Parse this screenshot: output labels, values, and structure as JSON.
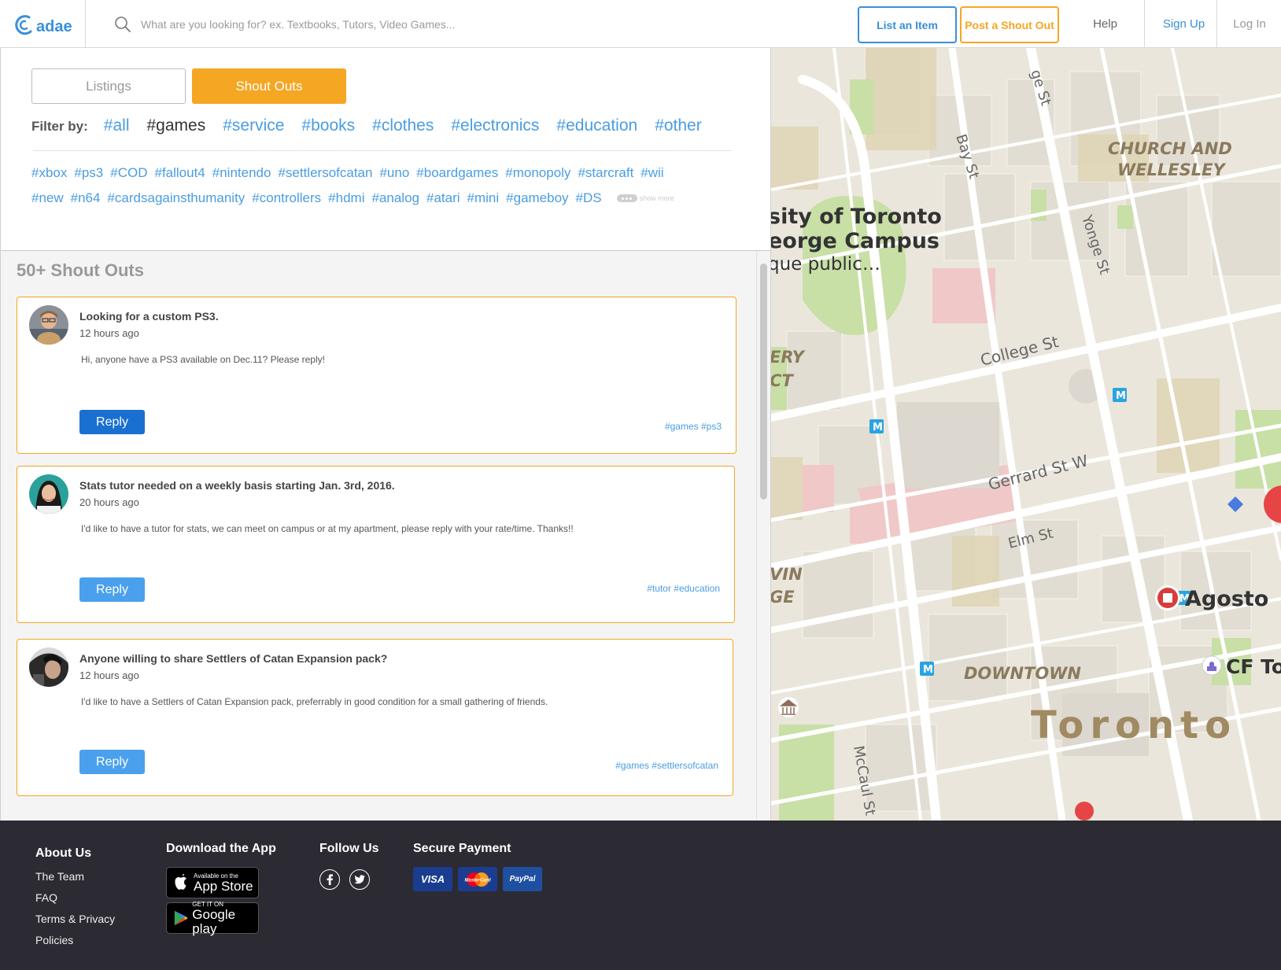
{
  "header": {
    "logo_text": "adae",
    "search_placeholder": "What are you looking for? ex. Textbooks, Tutors, Video Games...",
    "list_item_label": "List an Item",
    "post_shout_label": "Post a Shout Out",
    "help_label": "Help",
    "signup_label": "Sign Up",
    "login_label": "Log In"
  },
  "tabs": {
    "listings": "Listings",
    "shoutouts": "Shout Outs"
  },
  "filter": {
    "label": "Filter by:",
    "categories": [
      "#all",
      "#games",
      "#service",
      "#books",
      "#clothes",
      "#electronics",
      "#education",
      "#other"
    ],
    "active": "#games"
  },
  "tags": {
    "row1": [
      "#xbox",
      "#ps3",
      "#COD",
      "#fallout4",
      "#nintendo",
      "#settlersofcatan",
      "#uno",
      "#boardgames",
      "#monopoly",
      "#starcraft",
      "#wii"
    ],
    "row2": [
      "#new",
      "#n64",
      "#cardsagainsthumanity",
      "#controllers",
      "#hdmi",
      "#analog",
      "#atari",
      "#mini",
      "#gameboy",
      "#DS"
    ],
    "show_more": "show more"
  },
  "feed": {
    "title": "50+ Shout Outs",
    "posts": [
      {
        "title": "Looking for a custom PS3.",
        "time": "12 hours ago",
        "body": "Hi, anyone have a PS3 available on Dec.11?  Please reply!",
        "reply": "Reply",
        "tags": "#games #ps3"
      },
      {
        "title": "Stats tutor needed on a weekly basis starting Jan. 3rd, 2016.",
        "time": "20 hours ago",
        "body": "I'd like to have a tutor for stats, we can meet on campus or at my apartment, please reply with your rate/time. Thanks!!",
        "reply": "Reply",
        "tags": "#tutor #education"
      },
      {
        "title": "Anyone willing to share Settlers of Catan Expansion pack?",
        "time": "12 hours ago",
        "body": "I'd like to have a Settlers of Catan Expansion pack, preferrably in good condition for a small gathering of friends.",
        "reply": "Reply",
        "tags": "#games #settlersofcatan"
      }
    ]
  },
  "map": {
    "labels": {
      "bay": "Bay St",
      "yonge": "Yonge St",
      "college": "College St",
      "gerrard": "Gerrard St W",
      "elm": "Elm St",
      "mccaul": "McCaul St",
      "church1": "CHURCH AND",
      "church2": "WELLESLEY",
      "uoft1": "sity of Toronto",
      "uoft2": "eorge Campus",
      "uoft3": "que public…",
      "ery": "ERY",
      "ct": "CT",
      "vin": "VIN",
      "ge": "GE",
      "downtown": "DOWNTOWN",
      "toronto": "Toronto",
      "agosto": "Agosto",
      "cf": "CF Tor",
      "topst": "ge St"
    },
    "metro_glyph": "M"
  },
  "footer": {
    "about_heading": "About Us",
    "about_links": [
      "The Team",
      "FAQ",
      "Terms & Privacy",
      "Policies"
    ],
    "download_heading": "Download the App",
    "appstore_small": "Available on the",
    "appstore_big": "App Store",
    "googleplay_small": "GET IT ON",
    "googleplay_big": "Google play",
    "follow_heading": "Follow Us",
    "payment_heading": "Secure Payment",
    "payments": [
      "VISA",
      "MasterCard",
      "PayPal"
    ]
  },
  "colors": {
    "brand_blue": "#3a8fd8",
    "accent_orange": "#f5a623",
    "footer_bg": "#2c2b33"
  }
}
